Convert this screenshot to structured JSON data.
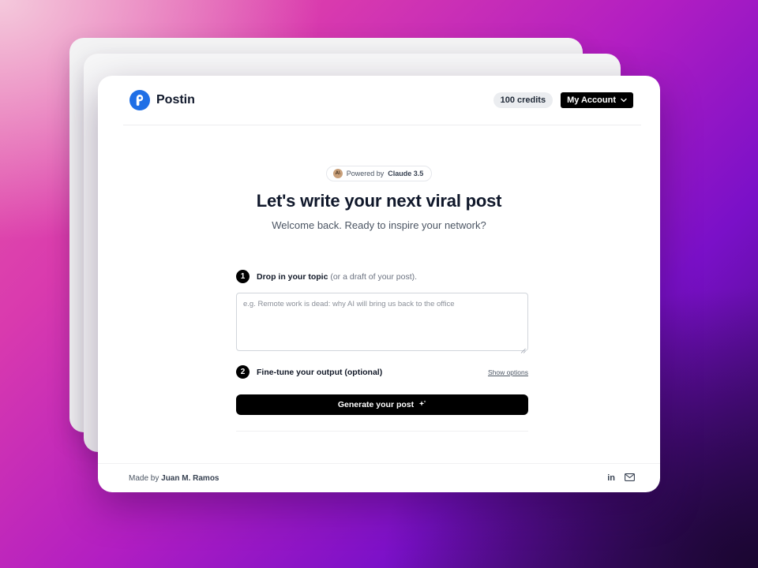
{
  "header": {
    "brand_name": "Postin",
    "credits": "100 credits",
    "account_label": "My Account"
  },
  "hero": {
    "powered_prefix": "Powered by",
    "powered_model": "Claude 3.5",
    "title": "Let's write your next viral post",
    "subtitle": "Welcome back. Ready to inspire your network?"
  },
  "form": {
    "step1": {
      "number": "1",
      "label": "Drop in your topic",
      "hint": "(or a draft of your post)."
    },
    "topic": {
      "value": "",
      "placeholder": "e.g. Remote work is dead: why AI will bring us back to the office"
    },
    "step2": {
      "number": "2",
      "label": "Fine-tune your output (optional)",
      "show_options": "Show options"
    },
    "generate_label": "Generate your post"
  },
  "footer": {
    "made_by_prefix": "Made by",
    "author": "Juan M. Ramos",
    "linkedin_label": "in"
  },
  "colors": {
    "brand_blue": "#1f6fe6",
    "button_black": "#000000",
    "background_gradient": [
      "#e85aa8",
      "#b21ec2",
      "#7a10c8",
      "#3a0a6e"
    ]
  },
  "icons": {
    "logo": "postin-logo-icon",
    "dropdown": "chevron-down-icon",
    "model": "claude-icon",
    "generate": "sparkles-icon",
    "linkedin": "linkedin-icon",
    "email": "mail-icon"
  }
}
